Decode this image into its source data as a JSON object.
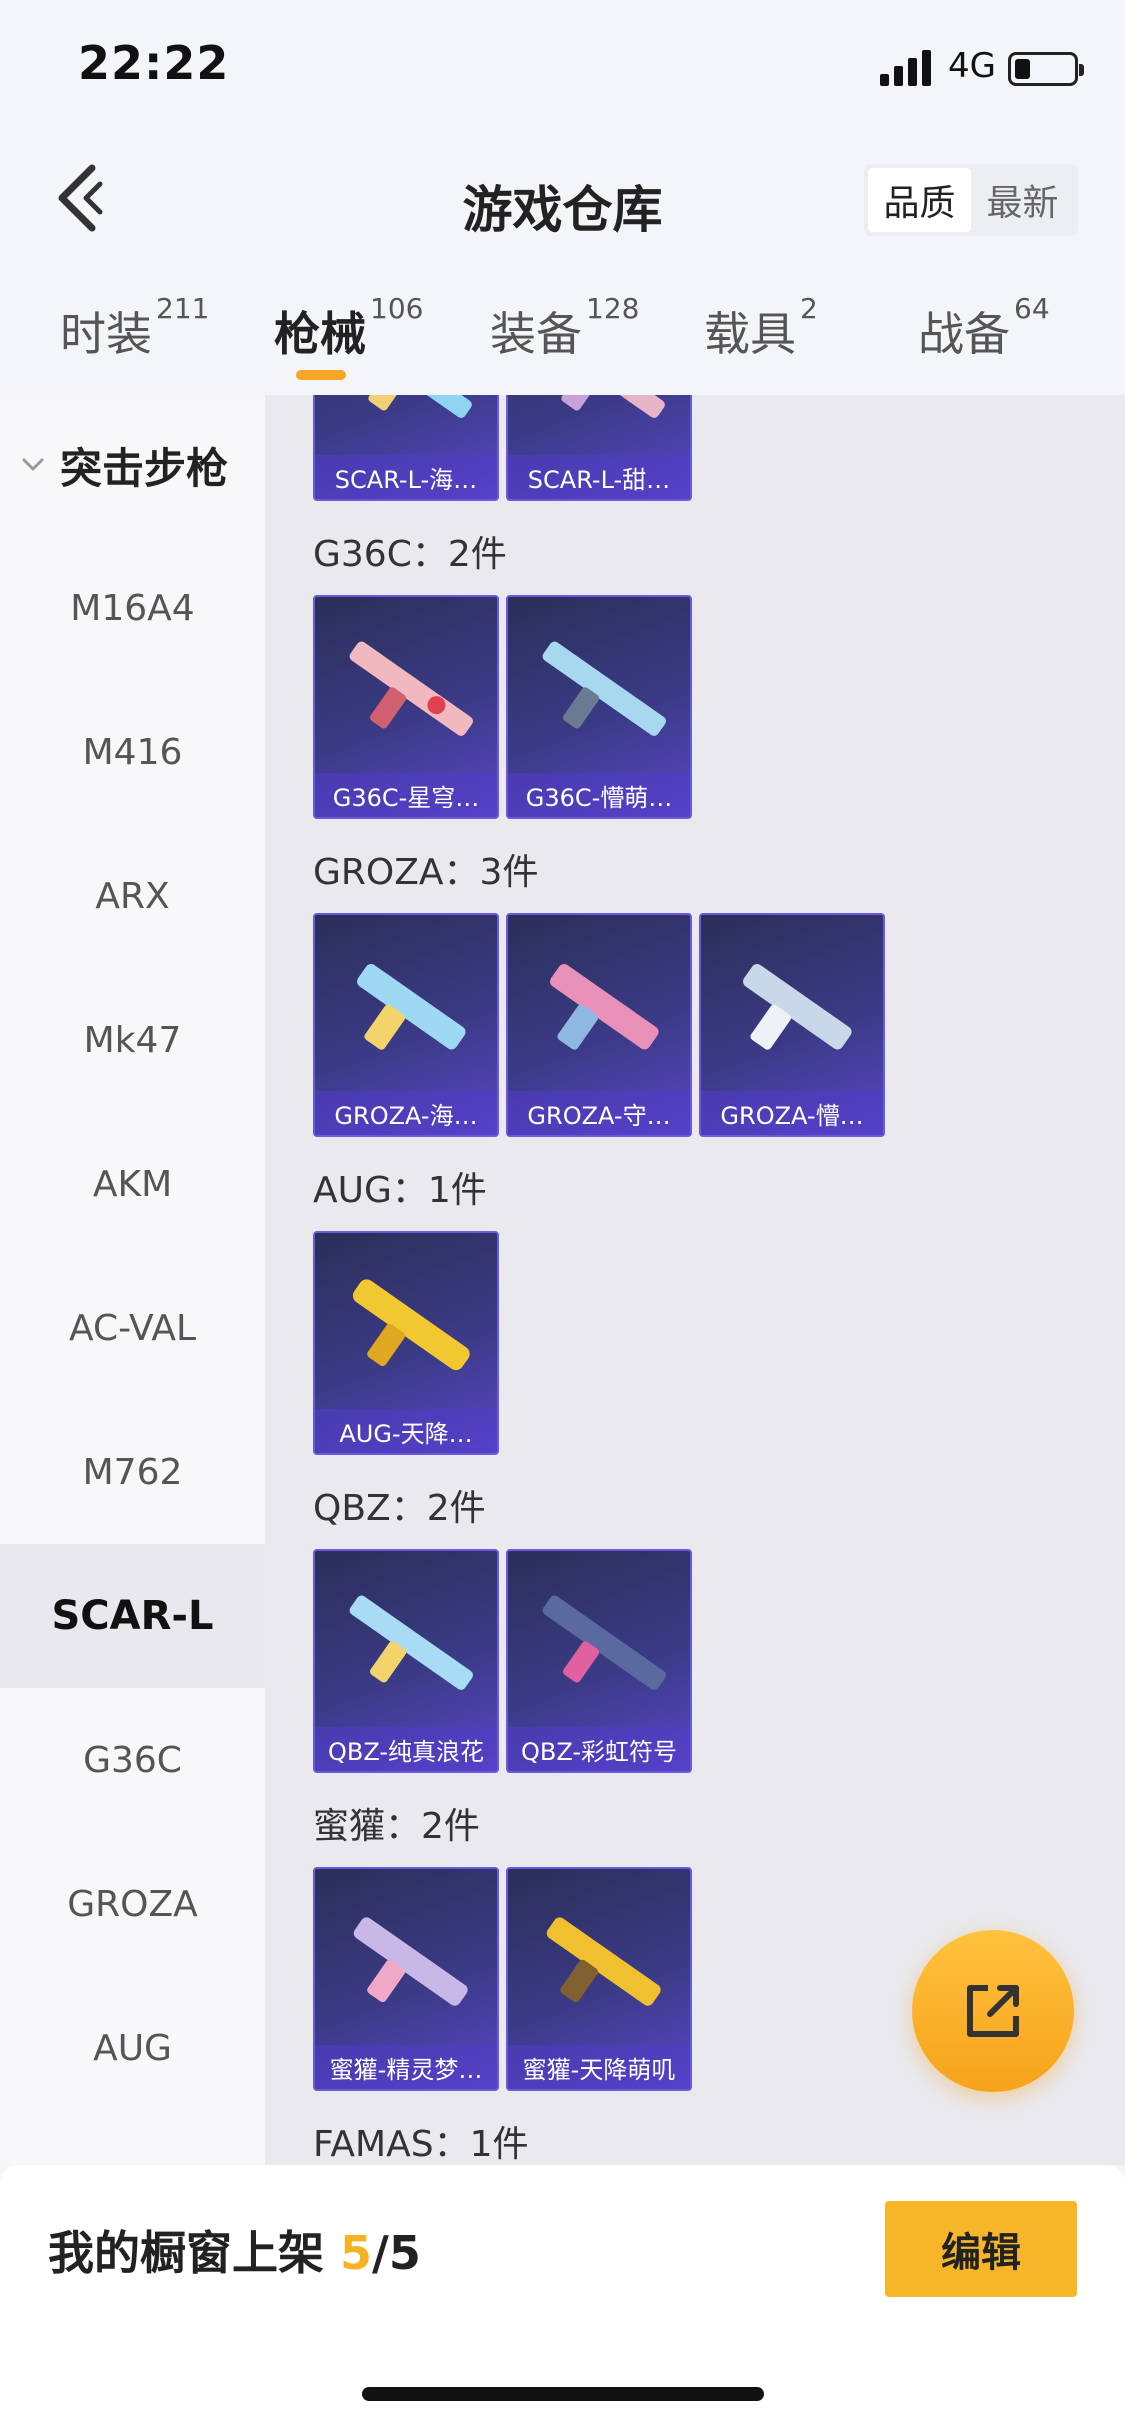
{
  "status": {
    "time": "22:22",
    "network": "4G",
    "battery_level": 0.25
  },
  "header": {
    "title": "游戏仓库",
    "sort_quality": "品质",
    "sort_newest": "最新"
  },
  "tabs": [
    {
      "label": "时装",
      "count": "211"
    },
    {
      "label": "枪械",
      "count": "106"
    },
    {
      "label": "装备",
      "count": "128"
    },
    {
      "label": "载具",
      "count": "2"
    },
    {
      "label": "战备",
      "count": "64"
    }
  ],
  "sidebar": {
    "group": "突击步枪",
    "items": [
      "M16A4",
      "M416",
      "ARX",
      "Mk47",
      "AKM",
      "AC-VAL",
      "M762",
      "SCAR-L",
      "G36C",
      "GROZA",
      "AUG"
    ]
  },
  "sections": [
    {
      "title": "",
      "cards": [
        "SCAR-L-海…",
        "SCAR-L-甜…"
      ]
    },
    {
      "title": "G36C：2件",
      "cards": [
        "G36C-星穹…",
        "G36C-懵萌…"
      ]
    },
    {
      "title": "GROZA：3件",
      "cards": [
        "GROZA-海…",
        "GROZA-守…",
        "GROZA-懵…"
      ]
    },
    {
      "title": "AUG：1件",
      "cards": [
        "AUG-天降…"
      ]
    },
    {
      "title": "QBZ：2件",
      "cards": [
        "QBZ-纯真浪花",
        "QBZ-彩虹符号"
      ]
    },
    {
      "title": "蜜獾：2件",
      "cards": [
        "蜜獾-精灵梦…",
        "蜜獾-天降萌叽"
      ]
    },
    {
      "title": "FAMAS：1件",
      "cards": []
    }
  ],
  "bottom": {
    "showcase_label": "我的橱窗上架 ",
    "showcase_used": "5",
    "showcase_total": "/5",
    "edit_label": "编辑"
  },
  "colors": {
    "accent": "#f5a623",
    "card_bg": "#3b3a86",
    "card_border": "#6a5ae0"
  }
}
